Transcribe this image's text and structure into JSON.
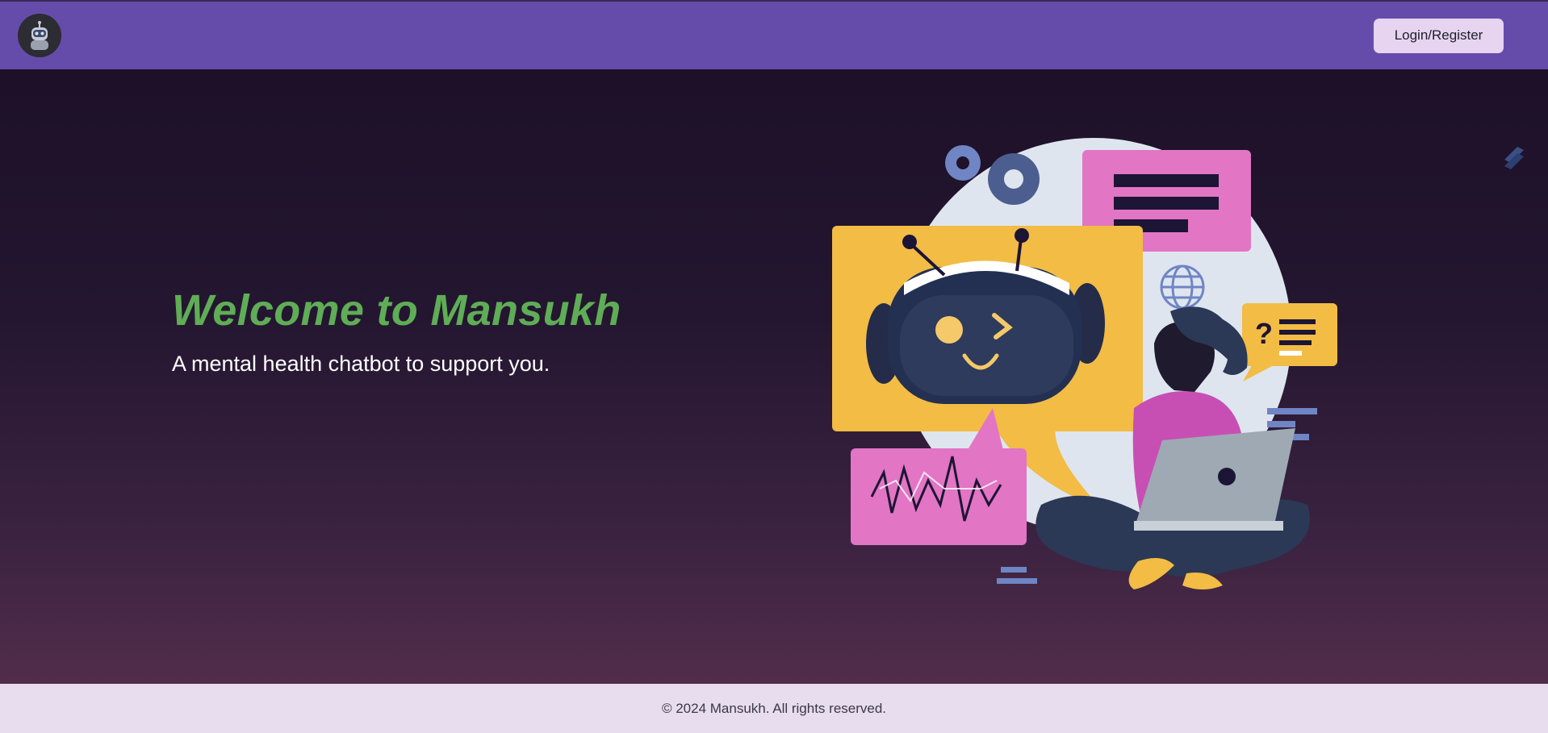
{
  "header": {
    "logo_icon": "robot-avatar-icon",
    "login_label": "Login/Register"
  },
  "hero": {
    "title": "Welcome to Mansukh",
    "subtitle": "A mental health chatbot to support you."
  },
  "illustration": {
    "icon": "chatbot-woman-laptop-illustration"
  },
  "side_icon": "stackshare-icon",
  "footer": {
    "copyright": "© 2024 Mansukh. All rights reserved."
  },
  "colors": {
    "header_bg": "#654cab",
    "title_green": "#5fad56",
    "button_bg": "#e6d4f1",
    "footer_bg": "#e8dcef",
    "pink": "#e275c4",
    "yellow": "#f2bc45",
    "navy": "#2b3856"
  }
}
